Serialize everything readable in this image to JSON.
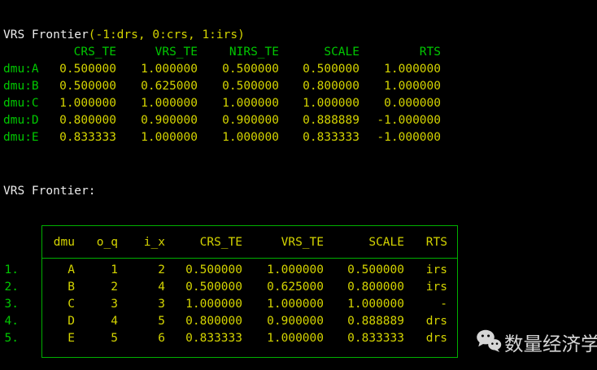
{
  "section1": {
    "title_prefix": "VRS Frontier",
    "title_args": "(-1:drs, 0:crs, 1:irs)",
    "headers": [
      "CRS_TE",
      "VRS_TE",
      "NIRS_TE",
      "SCALE",
      "RTS"
    ],
    "rows": [
      {
        "label": "dmu:A",
        "crs_te": "0.500000",
        "vrs_te": "1.000000",
        "nirs_te": "0.500000",
        "scale": "0.500000",
        "rts": "1.000000"
      },
      {
        "label": "dmu:B",
        "crs_te": "0.500000",
        "vrs_te": "0.625000",
        "nirs_te": "0.500000",
        "scale": "0.800000",
        "rts": "1.000000"
      },
      {
        "label": "dmu:C",
        "crs_te": "1.000000",
        "vrs_te": "1.000000",
        "nirs_te": "1.000000",
        "scale": "1.000000",
        "rts": "0.000000"
      },
      {
        "label": "dmu:D",
        "crs_te": "0.800000",
        "vrs_te": "0.900000",
        "nirs_te": "0.900000",
        "scale": "0.888889",
        "rts": "-1.000000"
      },
      {
        "label": "dmu:E",
        "crs_te": "0.833333",
        "vrs_te": "1.000000",
        "nirs_te": "1.000000",
        "scale": "0.833333",
        "rts": "-1.000000"
      }
    ]
  },
  "section2": {
    "title": "VRS Frontier:",
    "headers": [
      "dmu",
      "o_q",
      "i_x",
      "CRS_TE",
      "VRS_TE",
      "SCALE",
      "RTS"
    ],
    "rows": [
      {
        "num": "1.",
        "dmu": "A",
        "o_q": "1",
        "i_x": "2",
        "crs_te": "0.500000",
        "vrs_te": "1.000000",
        "scale": "0.500000",
        "rts": "irs"
      },
      {
        "num": "2.",
        "dmu": "B",
        "o_q": "2",
        "i_x": "4",
        "crs_te": "0.500000",
        "vrs_te": "0.625000",
        "scale": "0.800000",
        "rts": "irs"
      },
      {
        "num": "3.",
        "dmu": "C",
        "o_q": "3",
        "i_x": "3",
        "crs_te": "1.000000",
        "vrs_te": "1.000000",
        "scale": "1.000000",
        "rts": "-"
      },
      {
        "num": "4.",
        "dmu": "D",
        "o_q": "4",
        "i_x": "5",
        "crs_te": "0.800000",
        "vrs_te": "0.900000",
        "scale": "0.888889",
        "rts": "drs"
      },
      {
        "num": "5.",
        "dmu": "E",
        "o_q": "5",
        "i_x": "6",
        "crs_te": "0.833333",
        "vrs_te": "1.000000",
        "scale": "0.833333",
        "rts": "drs"
      }
    ]
  },
  "watermark": {
    "icon": "wechat-icon",
    "label": "数量经济学"
  },
  "colors": {
    "background": "#000000",
    "text_green": "#00c800",
    "text_yellow": "#d4d400",
    "text_white": "#ededed",
    "border_green": "#00b000",
    "watermark_gray": "#d6d6d6"
  }
}
